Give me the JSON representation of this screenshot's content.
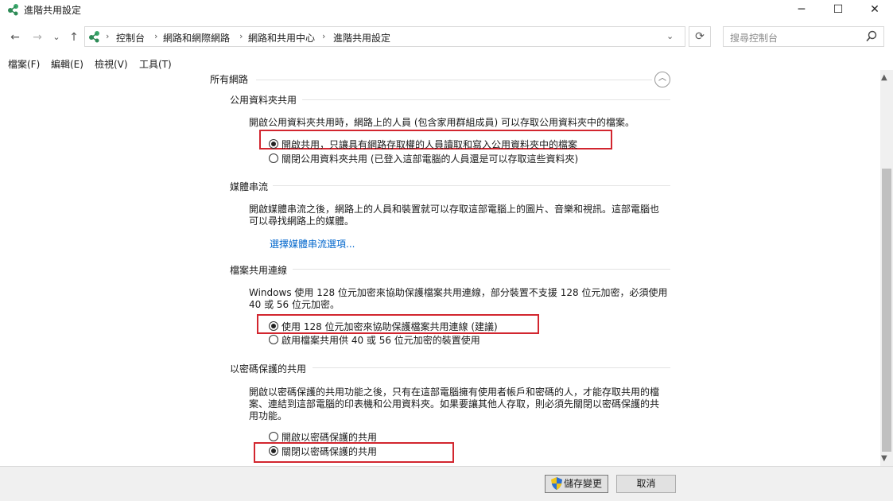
{
  "window": {
    "title": "進階共用設定",
    "minimize": "─",
    "maximize": "☐",
    "close": "✕"
  },
  "nav": {
    "back": "←",
    "forward": "→",
    "recent": "⌄",
    "up": "↑",
    "refresh": "⟳",
    "dropdown": "⌄"
  },
  "breadcrumb": {
    "items": [
      "控制台",
      "網路和網際網路",
      "網路和共用中心",
      "進階共用設定"
    ],
    "separator": "›"
  },
  "search": {
    "placeholder": "搜尋控制台"
  },
  "menu": {
    "items": [
      "檔案(F)",
      "編輯(E)",
      "檢視(V)",
      "工具(T)"
    ]
  },
  "group": {
    "title": "所有網路",
    "collapse": "︿"
  },
  "sections": {
    "public_folder": {
      "title": "公用資料夾共用",
      "description": "開啟公用資料夾共用時，網路上的人員 (包含家用群組成員) 可以存取公用資料夾中的檔案。",
      "options": [
        "開啟共用，只讓具有網路存取權的人員讀取和寫入公用資料夾中的檔案",
        "關閉公用資料夾共用 (已登入這部電腦的人員還是可以存取這些資料夾)"
      ],
      "selected": 0
    },
    "media": {
      "title": "媒體串流",
      "description_line1": "開啟媒體串流之後，網路上的人員和裝置就可以存取這部電腦上的圖片、音樂和視訊。這部電腦也",
      "description_line2": "可以尋找網路上的媒體。",
      "link": "選擇媒體串流選項..."
    },
    "file_sharing": {
      "title": "檔案共用連線",
      "description_line1": "Windows 使用 128 位元加密來協助保護檔案共用連線，部分裝置不支援 128 位元加密，必須使用",
      "description_line2": "40 或 56 位元加密。",
      "options": [
        "使用 128 位元加密來協助保護檔案共用連線 (建議)",
        "啟用檔案共用供 40 或 56 位元加密的裝置使用"
      ],
      "selected": 0
    },
    "password": {
      "title": "以密碼保護的共用",
      "description_line1": "開啟以密碼保護的共用功能之後，只有在這部電腦擁有使用者帳戶和密碼的人，才能存取共用的檔",
      "description_line2": "案、連結到這部電腦的印表機和公用資料夾。如果要讓其他人存取，則必須先關閉以密碼保護的共",
      "description_line3": "用功能。",
      "options": [
        "開啟以密碼保護的共用",
        "關閉以密碼保護的共用"
      ],
      "selected": 1
    }
  },
  "footer": {
    "save": "儲存變更",
    "cancel": "取消"
  },
  "colors": {
    "highlight_box": "#d2262f",
    "link": "#0066cc"
  },
  "icons": [
    "network-icon",
    "shield-icon",
    "search-icon",
    "collapse-icon",
    "refresh-icon"
  ]
}
